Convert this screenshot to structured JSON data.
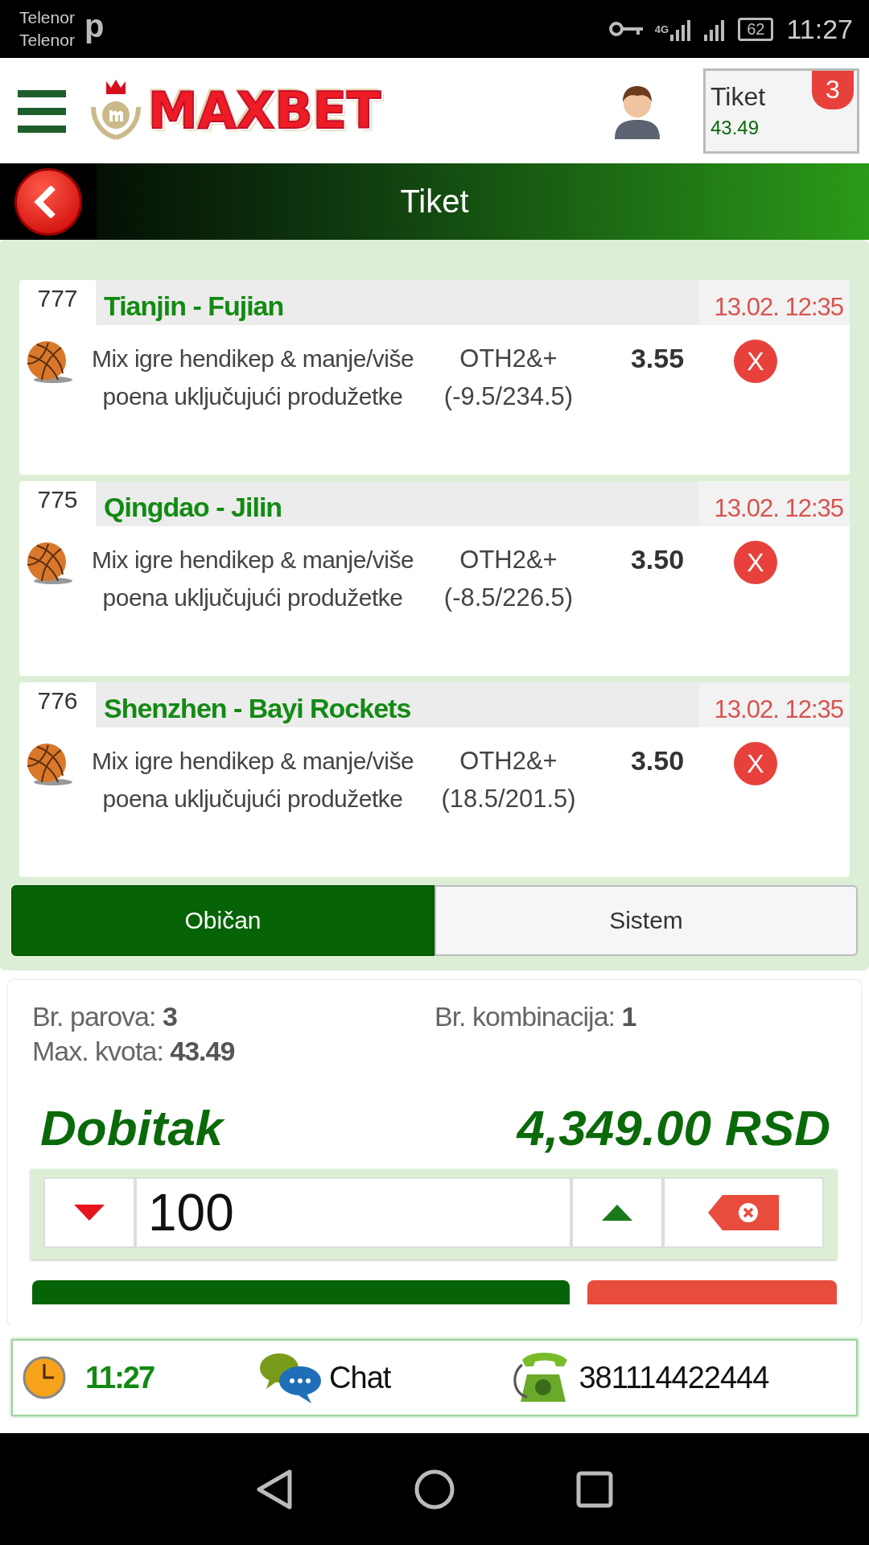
{
  "status_bar": {
    "carriers": [
      "Telenor",
      "Telenor"
    ],
    "notification": "p",
    "network": "4G",
    "battery": "62",
    "time": "11:27"
  },
  "header": {
    "logo": "MAXBET",
    "ticket": {
      "label": "Tiket",
      "total": "43.49",
      "count": "3"
    }
  },
  "title_bar": {
    "title": "Tiket"
  },
  "bets": [
    {
      "code": "777",
      "match": "Tianjin - Fujian",
      "time": "13.02. 12:35",
      "market": "Mix igre hendikep & manje/više poena uključujući produžetke",
      "pick": "OTH2&+",
      "line": "(-9.5/234.5)",
      "odds": "3.55",
      "remove": "X"
    },
    {
      "code": "775",
      "match": "Qingdao - Jilin",
      "time": "13.02. 12:35",
      "market": "Mix igre hendikep & manje/više poena uključujući produžetke",
      "pick": "OTH2&+",
      "line": "(-8.5/226.5)",
      "odds": "3.50",
      "remove": "X"
    },
    {
      "code": "776",
      "match": "Shenzhen - Bayi Rockets",
      "time": "13.02. 12:35",
      "market": "Mix igre hendikep & manje/više poena uključujući produžetke",
      "pick": "OTH2&+",
      "line": "(18.5/201.5)",
      "odds": "3.50",
      "remove": "X"
    }
  ],
  "bet_types": [
    {
      "label": "Običan",
      "selected": true
    },
    {
      "label": "Sistem",
      "selected": false
    }
  ],
  "summary": {
    "pairs_label": "Br. parova:",
    "pairs": "3",
    "combinations_label": "Br. kombinacija:",
    "combinations": "1",
    "max_odds_label": "Max. kvota:",
    "max_odds": "43.49",
    "win_label": "Dobitak",
    "win": "4,349.00 RSD"
  },
  "stake": {
    "value": "100"
  },
  "footer": {
    "time": "11:27",
    "chat": "Chat",
    "phone": "381114422444"
  }
}
